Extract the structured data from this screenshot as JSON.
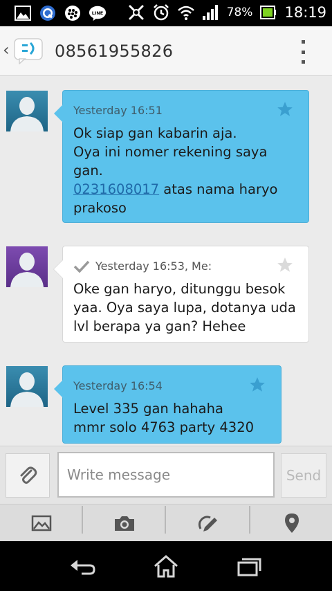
{
  "status_bar": {
    "battery_percent": "78%",
    "time": "18:19",
    "icons": [
      "gallery-icon",
      "qq-icon",
      "bbm-icon",
      "line-icon",
      "vibrate-off-icon",
      "alarm-icon",
      "wifi-icon",
      "signal-icon",
      "battery-icon"
    ]
  },
  "header": {
    "title": "08561955826"
  },
  "messages": [
    {
      "direction": "incoming",
      "timestamp": "Yesterday 16:51",
      "lines": [
        "Ok siap gan kabarin aja.",
        "Oya ini nomer rekening saya",
        "gan."
      ],
      "link": "0231608017",
      "link_tail": " atas nama haryo",
      "last_line": "prakoso",
      "avatar_color": "#2c7fa0"
    },
    {
      "direction": "outgoing",
      "timestamp": "Yesterday 16:53, Me:",
      "lines": [
        "Oke gan haryo, ditunggu besok",
        "yaa. Oya saya lupa, dotanya uda",
        "lvl berapa ya gan? Hehee"
      ],
      "avatar_color": "#6f3fa0"
    },
    {
      "direction": "incoming",
      "timestamp": "Yesterday 16:54",
      "lines": [
        "Level 335 gan hahaha",
        "mmr solo 4763 party 4320"
      ],
      "avatar_color": "#2c7fa0"
    }
  ],
  "compose": {
    "placeholder": "Write message",
    "send_label": "Send"
  },
  "colors": {
    "incoming_bubble": "#5bc2ec",
    "outgoing_bubble": "#ffffff",
    "star_incoming": "#3a9fd0",
    "link": "#1f69a8"
  }
}
